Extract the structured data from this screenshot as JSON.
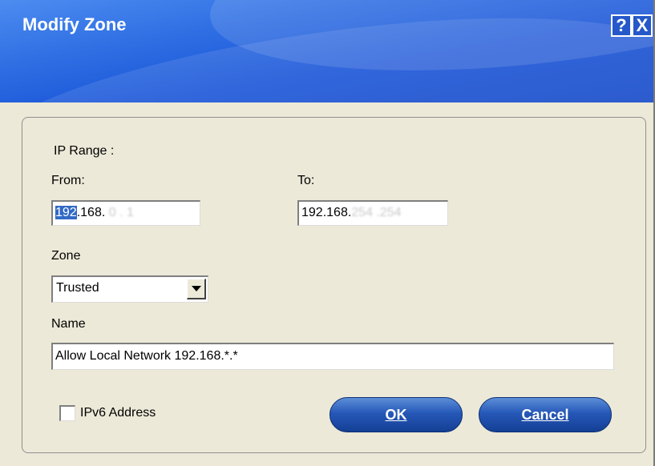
{
  "window": {
    "title": "Modify Zone",
    "help_label": "?",
    "close_label": "X"
  },
  "form": {
    "ip_range_label": "IP Range :",
    "from_label": "From:",
    "to_label": "To:",
    "from_ip": {
      "selected_part": "192",
      "visible_rest": ".168.",
      "blurred_part": "0 . 1"
    },
    "to_ip": {
      "visible_part": "192.168.",
      "blurred_part": "254 .254"
    },
    "zone_label": "Zone",
    "zone_value": "Trusted",
    "name_label": "Name",
    "name_value": "Allow Local Network 192.168.*.*",
    "ipv6_label": "IPv6 Address",
    "ipv6_checked": false
  },
  "buttons": {
    "ok_label": "OK",
    "cancel_label": "Cancel"
  },
  "colors": {
    "titlebar": "#2f6fe3",
    "dialog_bg": "#ece9d8",
    "button_blue": "#2658b8",
    "selection": "#316ac5"
  }
}
